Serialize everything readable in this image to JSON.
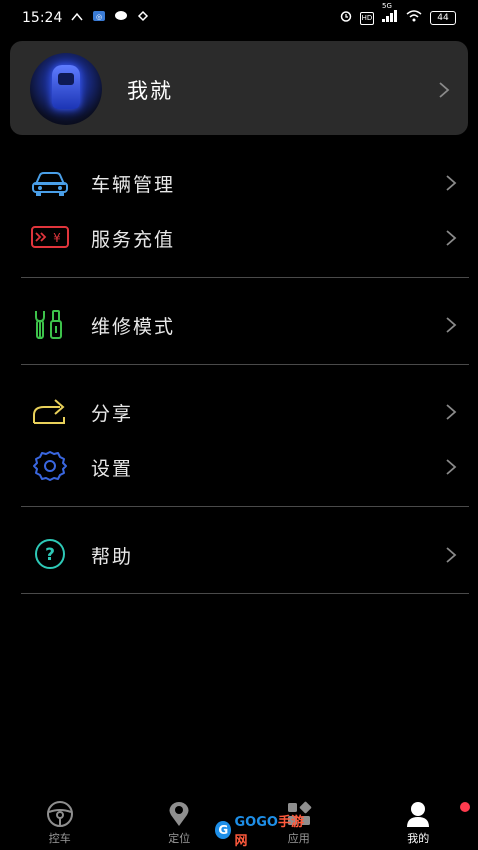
{
  "status_bar": {
    "time": "15:24",
    "hd_label": "HD",
    "network": "5G",
    "battery": "44"
  },
  "profile": {
    "name": "我就"
  },
  "menu": {
    "vehicle_management": "车辆管理",
    "service_recharge": "服务充值",
    "maintenance_mode": "维修模式",
    "share": "分享",
    "settings": "设置",
    "help": "帮助"
  },
  "bottom_nav": [
    {
      "label": "控车",
      "icon": "steering-wheel-icon"
    },
    {
      "label": "定位",
      "icon": "location-pin-icon"
    },
    {
      "label": "应用",
      "icon": "apps-grid-icon"
    },
    {
      "label": "我的",
      "icon": "person-icon"
    }
  ],
  "watermark": {
    "brand_a": "GOGO",
    "brand_b": "手游网"
  },
  "colors": {
    "vehicle_icon": "#4a9fe8",
    "service_icon": "#e0353c",
    "maintenance_icon": "#3dc24b",
    "share_icon": "#e8d05a",
    "settings_icon": "#3a67e0",
    "help_icon": "#2ec9b7",
    "badge": "#ff3b4e"
  }
}
